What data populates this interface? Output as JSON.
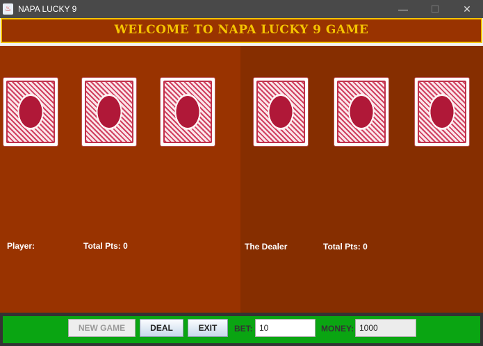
{
  "window": {
    "title": "NAPA LUCKY 9",
    "minimize": "—",
    "maximize": "☐",
    "close": "✕"
  },
  "banner": {
    "text": "WELCOME TO NAPA LUCKY 9 GAME"
  },
  "player": {
    "label": "Player:",
    "total_label": "Total Pts: 0",
    "cards": [
      "card-back",
      "card-back",
      "card-back"
    ]
  },
  "dealer": {
    "label": "The Dealer",
    "total_label": "Total Pts: 0",
    "cards": [
      "card-back",
      "card-back",
      "card-back"
    ]
  },
  "controls": {
    "new_game": "NEW GAME",
    "deal": "DEAL",
    "exit": "EXIT",
    "bet_label": "BET:",
    "bet_value": "10",
    "money_label": "MONEY:",
    "money_value": "1000"
  },
  "colors": {
    "banner_text": "#f5c400",
    "player_bg": "#993300",
    "dealer_bg": "#862e00",
    "control_bg": "#0aa512"
  }
}
